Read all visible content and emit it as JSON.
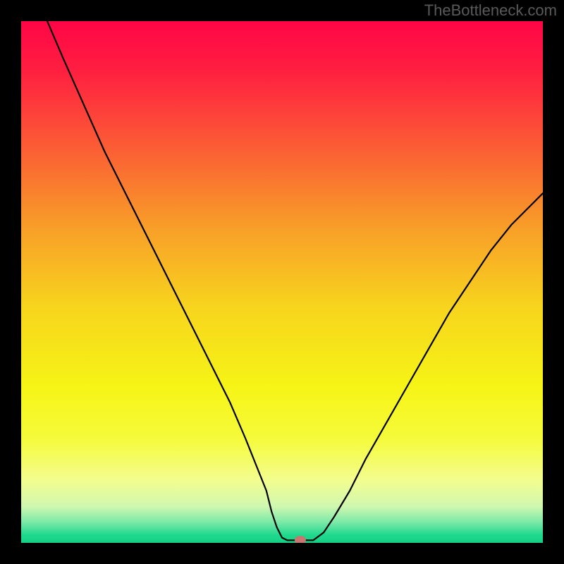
{
  "watermark": "TheBottleneck.com",
  "chart_data": {
    "type": "line",
    "title": "",
    "xlabel": "",
    "ylabel": "",
    "xlim": [
      0,
      100
    ],
    "ylim": [
      0,
      100
    ],
    "background_gradient_stops": [
      {
        "offset": 0.0,
        "color": "#ff0546"
      },
      {
        "offset": 0.1,
        "color": "#ff2140"
      },
      {
        "offset": 0.25,
        "color": "#fb6034"
      },
      {
        "offset": 0.4,
        "color": "#f8a028"
      },
      {
        "offset": 0.55,
        "color": "#f7d51d"
      },
      {
        "offset": 0.7,
        "color": "#f6f416"
      },
      {
        "offset": 0.8,
        "color": "#f5fb3a"
      },
      {
        "offset": 0.88,
        "color": "#f3fd8f"
      },
      {
        "offset": 0.93,
        "color": "#d0f8b0"
      },
      {
        "offset": 0.96,
        "color": "#7de9a8"
      },
      {
        "offset": 0.985,
        "color": "#1fd98e"
      },
      {
        "offset": 1.0,
        "color": "#14cf84"
      }
    ],
    "series": [
      {
        "name": "left-curve",
        "x": [
          5,
          8,
          12,
          16,
          20,
          24,
          28,
          32,
          36,
          40,
          43,
          45,
          47,
          48,
          49,
          50,
          51
        ],
        "y": [
          100,
          93,
          84,
          75,
          67,
          59,
          51,
          43,
          35,
          27,
          20,
          15,
          10,
          6,
          3,
          1,
          0.5
        ]
      },
      {
        "name": "flat-segment",
        "x": [
          51,
          56
        ],
        "y": [
          0.5,
          0.5
        ]
      },
      {
        "name": "right-curve",
        "x": [
          56,
          58,
          60,
          63,
          66,
          70,
          74,
          78,
          82,
          86,
          90,
          94,
          98,
          100
        ],
        "y": [
          0.5,
          2,
          5,
          10,
          16,
          23,
          30,
          37,
          44,
          50,
          56,
          61,
          65,
          67
        ]
      }
    ],
    "marker": {
      "name": "min-point-marker",
      "x": 53.5,
      "y": 0.5,
      "color": "#c97570",
      "rx": 8,
      "ry": 6
    }
  }
}
